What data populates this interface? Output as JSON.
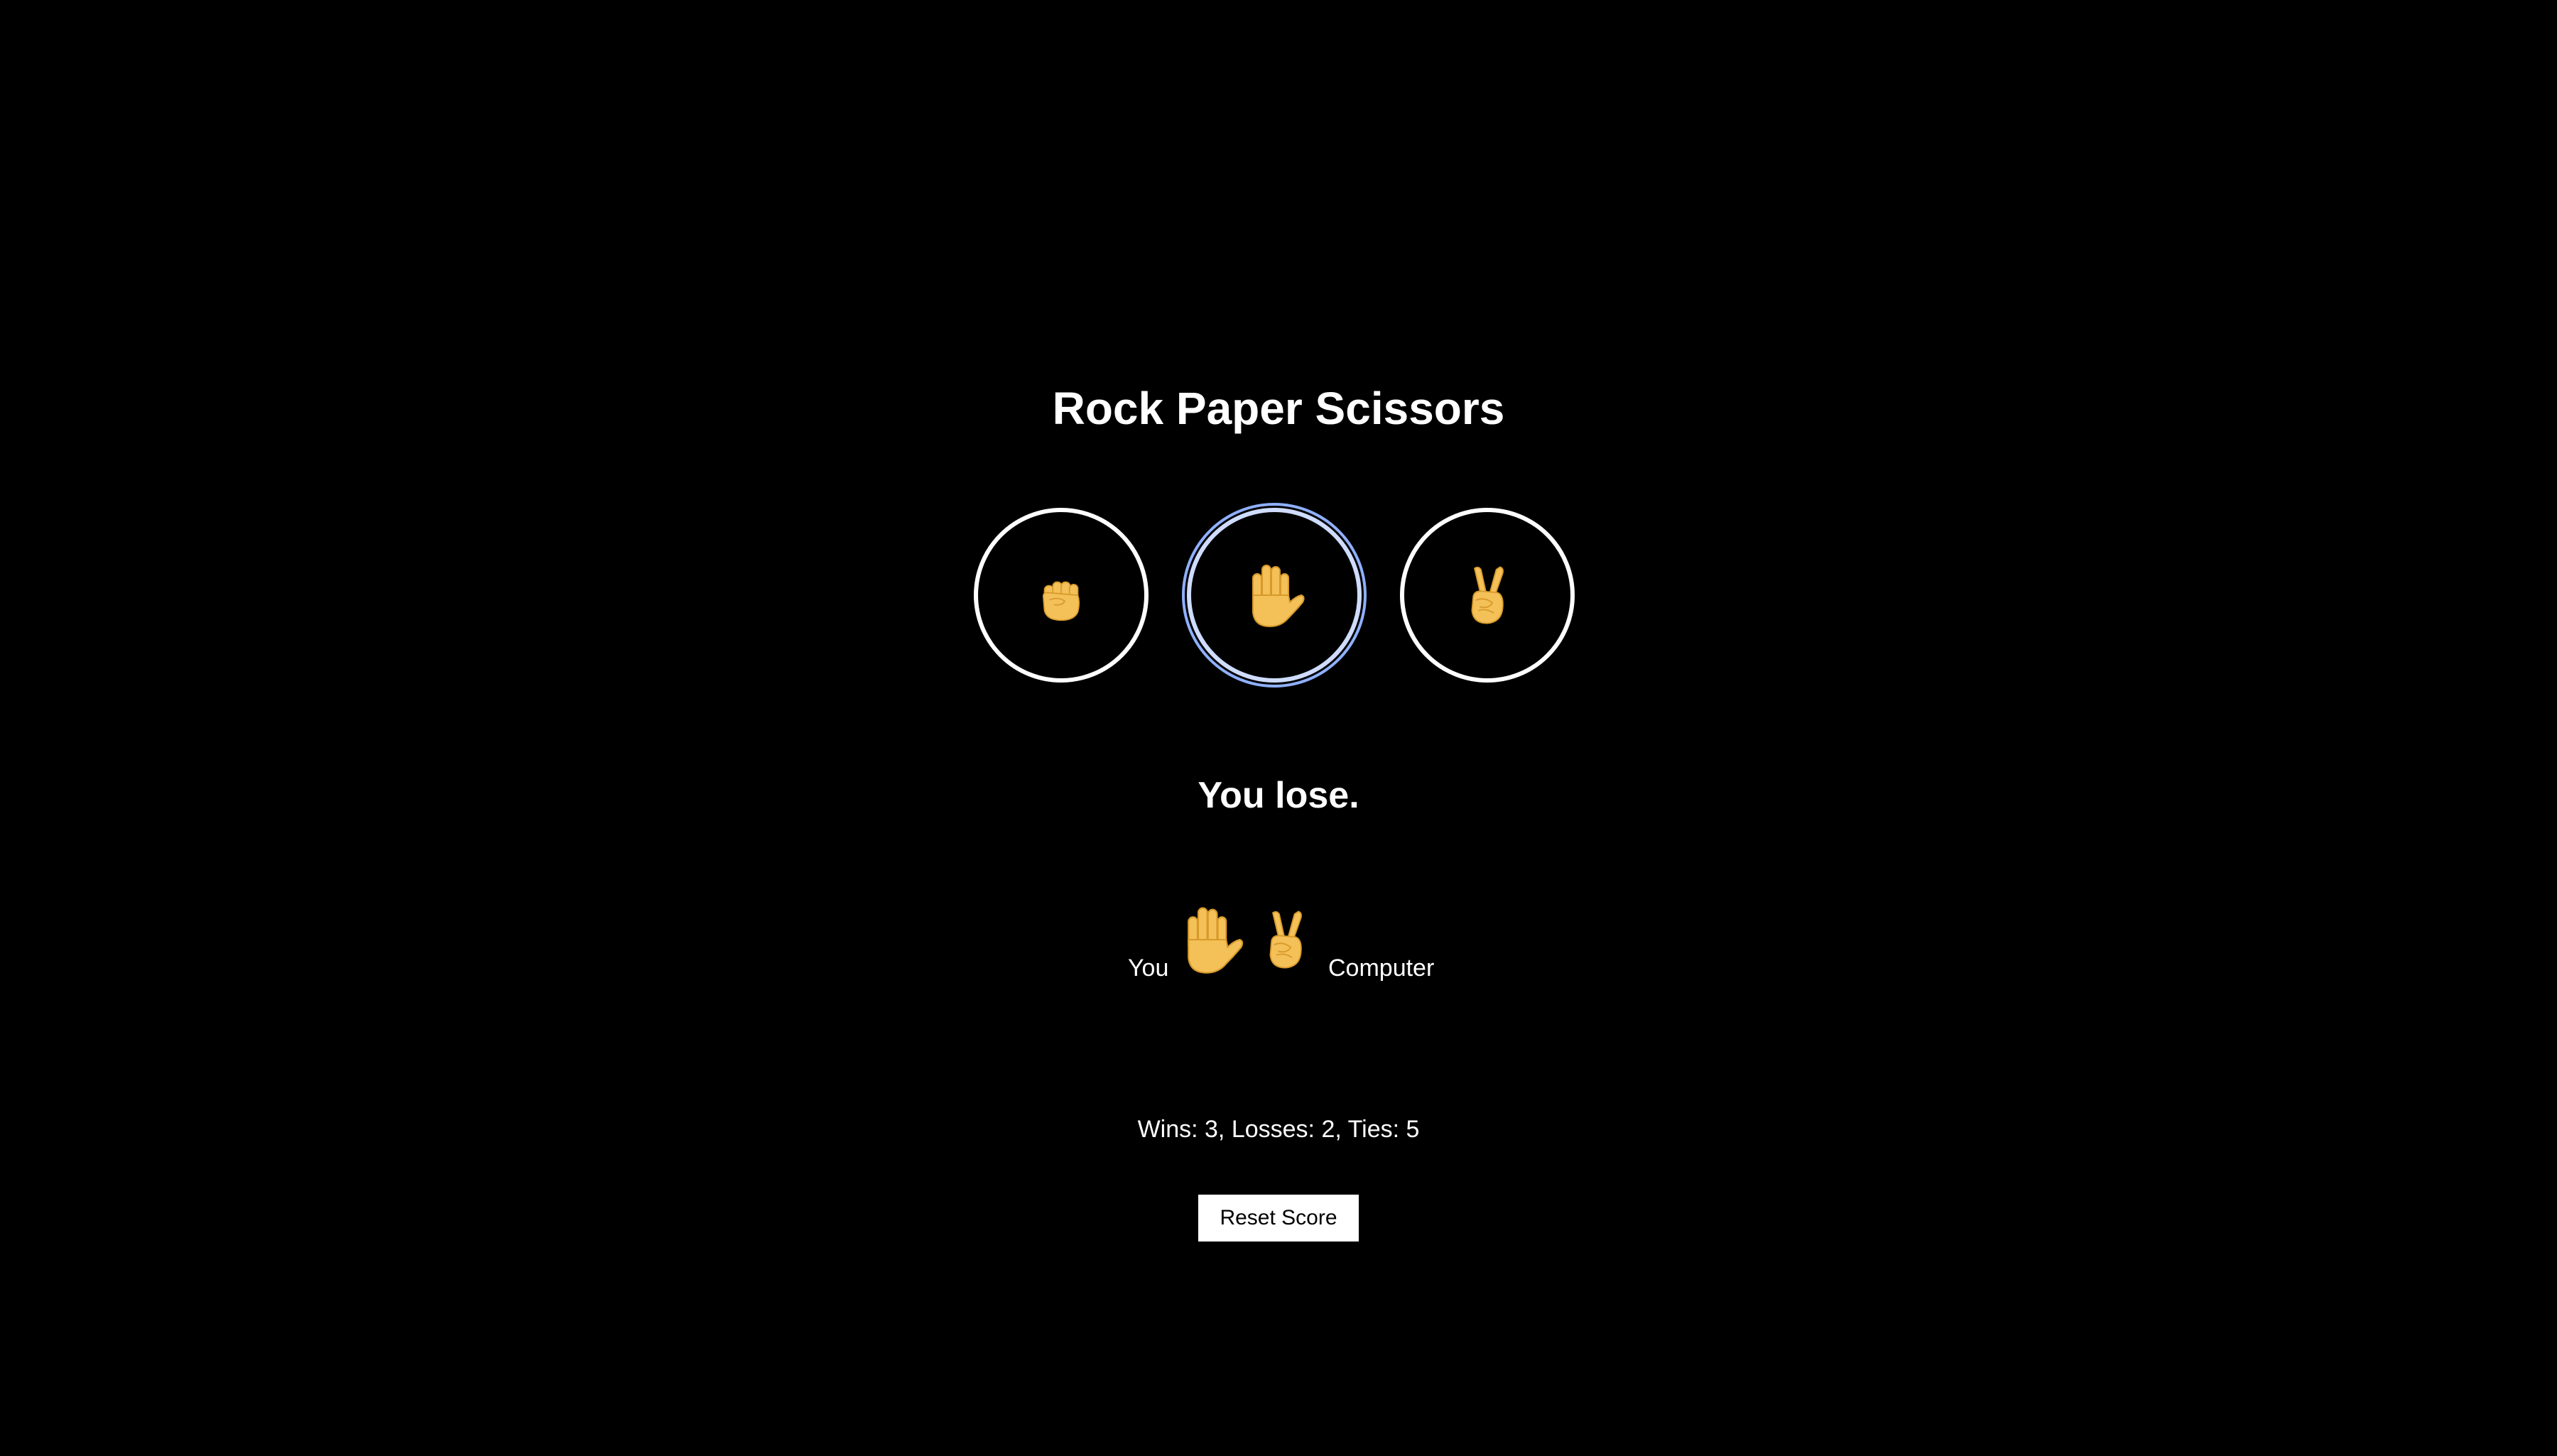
{
  "title": "Rock Paper Scissors",
  "moves": [
    {
      "name": "rock",
      "icon": "raised-fist-icon"
    },
    {
      "name": "paper",
      "icon": "raised-hand-icon"
    },
    {
      "name": "scissors",
      "icon": "victory-hand-icon"
    }
  ],
  "focused_move": "paper",
  "result": "You lose.",
  "round": {
    "you_label": "You",
    "computer_label": "Computer",
    "player_move": "paper",
    "computer_move": "scissors"
  },
  "score_text": "Wins: 3, Losses: 2, Ties: 5",
  "reset_label": "Reset Score",
  "colors": {
    "background": "#000000",
    "text": "#ffffff",
    "emoji": "#f4c058",
    "focus_ring": "#8fb0ff"
  }
}
